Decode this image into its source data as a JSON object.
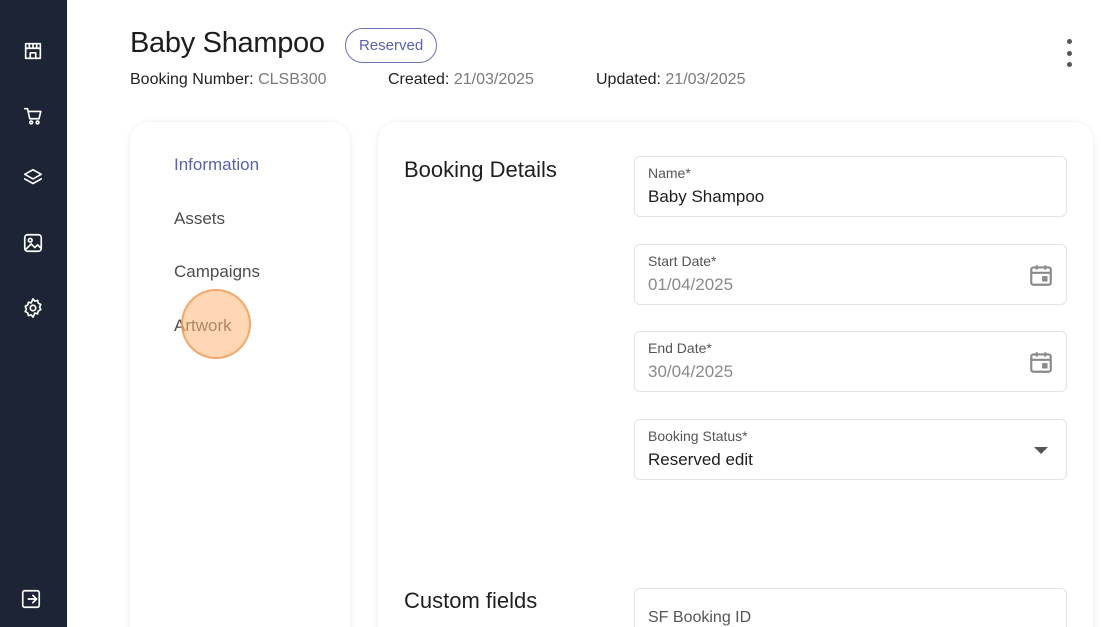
{
  "header": {
    "title": "Baby Shampoo",
    "status": "Reserved",
    "booking_number_label": "Booking Number:",
    "booking_number": "CLSB300",
    "created_label": "Created:",
    "created": "21/03/2025",
    "updated_label": "Updated:",
    "updated": "21/03/2025"
  },
  "sidebar": {
    "icons": [
      "store-icon",
      "cart-icon",
      "layers-icon",
      "image-icon",
      "gear-icon"
    ],
    "logout_icon": "logout-icon"
  },
  "side_nav": {
    "items": [
      {
        "label": "Information",
        "active": true
      },
      {
        "label": "Assets"
      },
      {
        "label": "Campaigns"
      },
      {
        "label": "Artwork"
      }
    ]
  },
  "booking_details": {
    "title": "Booking Details",
    "name": {
      "label": "Name*",
      "value": "Baby Shampoo"
    },
    "start_date": {
      "label": "Start Date*",
      "value": "01/04/2025"
    },
    "end_date": {
      "label": "End Date*",
      "value": "30/04/2025"
    },
    "status": {
      "label": "Booking Status*",
      "value": "Reserved edit"
    }
  },
  "custom_fields": {
    "title": "Custom fields",
    "sf_booking_id": {
      "label": "SF Booking ID"
    }
  },
  "colors": {
    "sidebar_bg": "#1c2436",
    "accent": "#5a5fb0"
  }
}
